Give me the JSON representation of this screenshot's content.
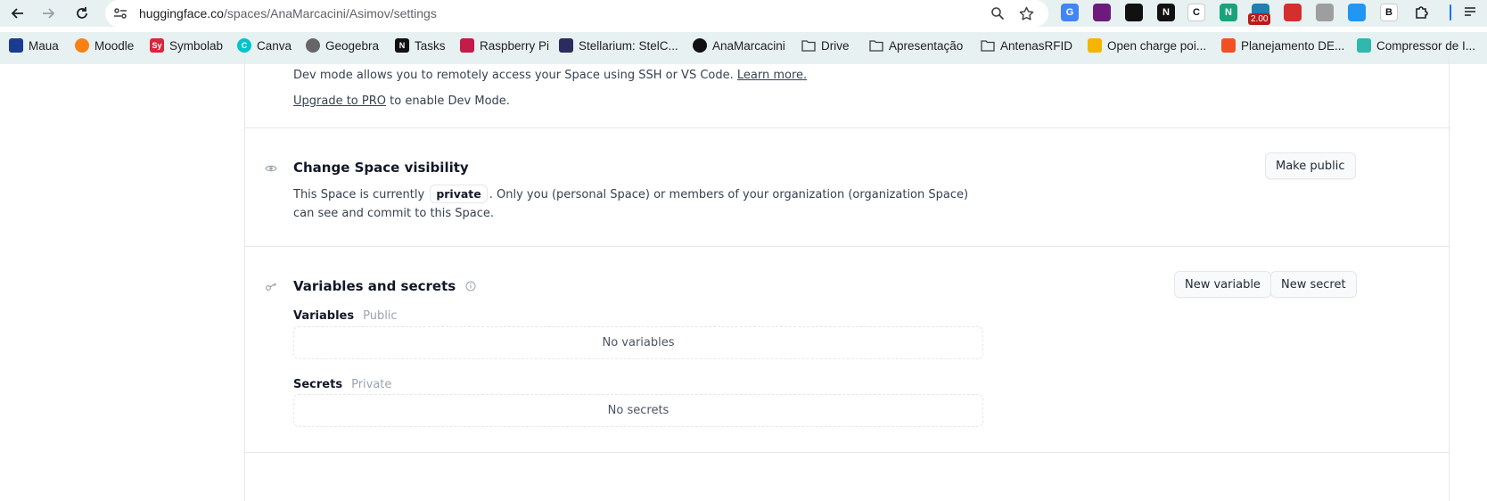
{
  "browser": {
    "url_host": "huggingface.co",
    "url_path": "/spaces/AnaMarcacini/Asimov/settings",
    "extensions": [
      {
        "name": "google-translate-icon",
        "color": "#4285f4",
        "text": "G"
      },
      {
        "name": "extension-magenta-icon",
        "color": "#6d1b7b",
        "text": ""
      },
      {
        "name": "extension-send-icon",
        "color": "#111111",
        "text": ""
      },
      {
        "name": "notion-icon",
        "color": "#111111",
        "text": "N"
      },
      {
        "name": "extension-c-icon",
        "color": "#ffffff",
        "text": "C"
      },
      {
        "name": "extension-n-icon",
        "color": "#18a37a",
        "text": "N"
      },
      {
        "name": "speed-extension-icon",
        "color": "#1e7fb0",
        "text": ""
      },
      {
        "name": "extension-red-icon",
        "color": "#d32f2f",
        "text": ""
      },
      {
        "name": "extension-grey-icon",
        "color": "#9e9e9e",
        "text": ""
      },
      {
        "name": "extension-blue-icon",
        "color": "#2196f3",
        "text": ""
      },
      {
        "name": "extension-b-icon",
        "color": "#ffffff",
        "text": "B"
      }
    ],
    "speed_badge": "2.00",
    "bookmarks": [
      {
        "label": "Maua",
        "color": "#1a3c8f",
        "icon": "maua-icon"
      },
      {
        "label": "Moodle",
        "color": "#f98012",
        "icon": "moodle-icon"
      },
      {
        "label": "Symbolab",
        "color": "#d7263d",
        "icon": "symbolab-icon",
        "glyph": "Sy"
      },
      {
        "label": "Canva",
        "color": "#00c4cc",
        "icon": "canva-icon",
        "glyph": "C"
      },
      {
        "label": "Geogebra",
        "color": "#666666",
        "icon": "geogebra-icon"
      },
      {
        "label": "Tasks",
        "color": "#111111",
        "icon": "notion-icon",
        "glyph": "N"
      },
      {
        "label": "Raspberry Pi",
        "color": "#c51a4a",
        "icon": "raspberry-icon"
      },
      {
        "label": "Stellarium: StelC...",
        "color": "#2b2b5e",
        "icon": "stellarium-icon"
      },
      {
        "label": "AnaMarcacini",
        "color": "#111111",
        "icon": "github-icon"
      },
      {
        "label": "Drive",
        "color": "",
        "icon": "folder-icon"
      },
      {
        "label": "Apresentação",
        "color": "",
        "icon": "folder-icon"
      },
      {
        "label": "AntenasRFID",
        "color": "",
        "icon": "folder-icon"
      },
      {
        "label": "Open charge poi...",
        "color": "#f5b400",
        "icon": "open-charge-icon"
      },
      {
        "label": "Planejamento DE...",
        "color": "#f25022",
        "icon": "microsoft-icon"
      },
      {
        "label": "Compressor de I...",
        "color": "#2fb8ac",
        "icon": "compressor-icon"
      }
    ]
  },
  "dev_mode": {
    "description": "Dev mode allows you to remotely access your Space using SSH or VS Code.",
    "learn_more": "Learn more.",
    "upgrade_link": "Upgrade to PRO",
    "upgrade_suffix": " to enable Dev Mode."
  },
  "visibility": {
    "title": "Change Space visibility",
    "button": "Make public",
    "text_before": "This Space is currently",
    "badge": "private",
    "text_after": ". Only you (personal Space) or members of your organization (organization Space) can see and",
    "text_line2": "commit to this Space."
  },
  "variables_secrets": {
    "title": "Variables and secrets",
    "new_variable_button": "New variable",
    "new_secret_button": "New secret",
    "variables_label": "Variables",
    "variables_hint": "Public",
    "variables_empty": "No variables",
    "secrets_label": "Secrets",
    "secrets_hint": "Private",
    "secrets_empty": "No secrets"
  }
}
